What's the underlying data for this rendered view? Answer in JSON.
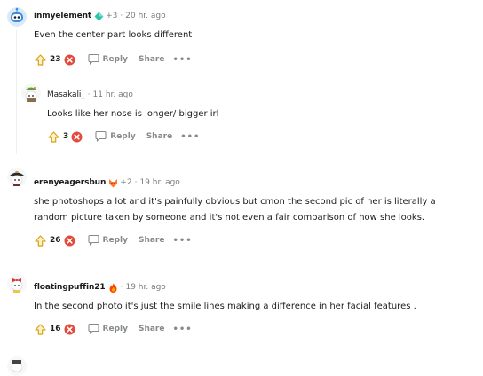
{
  "comments": [
    {
      "username": "inmyelement",
      "karma": "+3",
      "time": "20 hr. ago",
      "text": "Even the center part looks different",
      "score": "23",
      "reply_label": "Reply",
      "share_label": "Share",
      "more_label": "•••",
      "flair_icon": "teal-gem-icon",
      "avatar_icon": "snoo-robot-avatar-icon"
    },
    {
      "username": "Masakali_",
      "time": "11 hr. ago",
      "text": "Looks like her nose is longer/ bigger irl",
      "score": "3",
      "reply_label": "Reply",
      "share_label": "Share",
      "more_label": "•••",
      "avatar_icon": "snoo-green-hat-avatar-icon"
    },
    {
      "username": "erenyeagersbun",
      "karma": "+2",
      "time": "19 hr. ago",
      "text": "she photoshops a lot and it's painfully obvious but cmon the second pic of her is literally a random picture taken by someone and it's not even a fair comparison of how she looks.",
      "score": "26",
      "reply_label": "Reply",
      "share_label": "Share",
      "more_label": "•••",
      "flair_icon": "fox-face-icon",
      "avatar_icon": "snoo-pirate-hat-avatar-icon"
    },
    {
      "username": "floatingpuffin21",
      "time": "19 hr. ago",
      "text": "In the second photo it's just the smile lines making a difference in her facial features .",
      "score": "16",
      "reply_label": "Reply",
      "share_label": "Share",
      "more_label": "•••",
      "flair_icon": "fire-badge-icon",
      "avatar_icon": "snoo-red-bow-avatar-icon"
    }
  ],
  "colors": {
    "upvote_outline": "#d7a21a",
    "downvote_red": "#e24a3c",
    "meta_gray": "#787c7e",
    "action_gray": "#878a8c"
  }
}
